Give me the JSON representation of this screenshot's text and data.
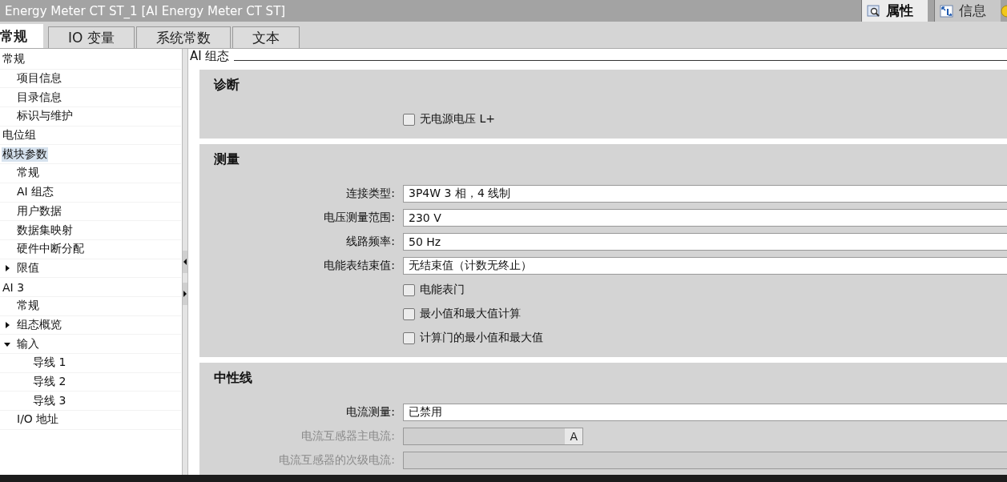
{
  "window": {
    "title": "Energy Meter CT ST_1 [AI Energy Meter CT ST]"
  },
  "inspector_tabs": [
    {
      "label": "属性",
      "selected": true,
      "kind": "search"
    },
    {
      "label": "信息",
      "selected": false,
      "kind": "info"
    }
  ],
  "tabs": [
    {
      "label": "常规",
      "selected": true
    },
    {
      "label": "IO 变量",
      "selected": false
    },
    {
      "label": "系统常数",
      "selected": false
    },
    {
      "label": "文本",
      "selected": false
    }
  ],
  "tree": [
    {
      "label": "常规",
      "selected": false,
      "children": [
        {
          "label": "项目信息",
          "selected": false
        },
        {
          "label": "目录信息",
          "selected": false
        },
        {
          "label": "标识与维护",
          "selected": false
        }
      ]
    },
    {
      "label": "电位组",
      "selected": false
    },
    {
      "label": "模块参数",
      "selected": true,
      "children": [
        {
          "label": "常规",
          "selected": false
        },
        {
          "label": "AI 组态",
          "selected": false
        },
        {
          "label": "用户数据",
          "selected": false
        },
        {
          "label": "数据集映射",
          "selected": false
        },
        {
          "label": "硬件中断分配",
          "selected": false
        },
        {
          "label": "限值",
          "selected": false,
          "expanded": false
        }
      ]
    },
    {
      "label": "AI 3",
      "selected": false,
      "children": [
        {
          "label": "常规",
          "selected": false
        },
        {
          "label": "组态概览",
          "selected": false,
          "expanded": false
        },
        {
          "label": "输入",
          "selected": false,
          "expanded": true,
          "children": [
            {
              "label": "导线 1",
              "selected": false
            },
            {
              "label": "导线 2",
              "selected": false
            },
            {
              "label": "导线 3",
              "selected": false
            }
          ]
        },
        {
          "label": "I/O 地址",
          "selected": false
        }
      ]
    }
  ],
  "page_title": "AI 组态",
  "sections": [
    {
      "title": "诊断",
      "rows": [
        {
          "kind": "checkbox",
          "label": "无电源电压 L+",
          "checked": false
        }
      ]
    },
    {
      "title": "测量",
      "rows": [
        {
          "kind": "field",
          "label": "连接类型:",
          "value": "3P4W 3 相，4 线制",
          "disabled": false
        },
        {
          "kind": "field",
          "label": "电压测量范围:",
          "value": "230 V",
          "disabled": false
        },
        {
          "kind": "field",
          "label": "线路频率:",
          "value": "50 Hz",
          "disabled": false
        },
        {
          "kind": "field",
          "label": "电能表结束值:",
          "value": "无结束值（计数无终止）",
          "disabled": false
        },
        {
          "kind": "checkbox",
          "label": "电能表门",
          "checked": false
        },
        {
          "kind": "checkbox",
          "label": "最小值和最大值计算",
          "checked": false
        },
        {
          "kind": "checkbox",
          "label": "计算门的最小值和最大值",
          "checked": false
        }
      ]
    },
    {
      "title": "中性线",
      "rows": [
        {
          "kind": "field",
          "label": "电流测量:",
          "value": "已禁用",
          "disabled": false
        },
        {
          "kind": "field",
          "label": "电流互感器主电流:",
          "disabled": true,
          "unit": "A"
        },
        {
          "kind": "field",
          "label": "电流互感器的次级电流:",
          "disabled": true
        }
      ]
    }
  ]
}
